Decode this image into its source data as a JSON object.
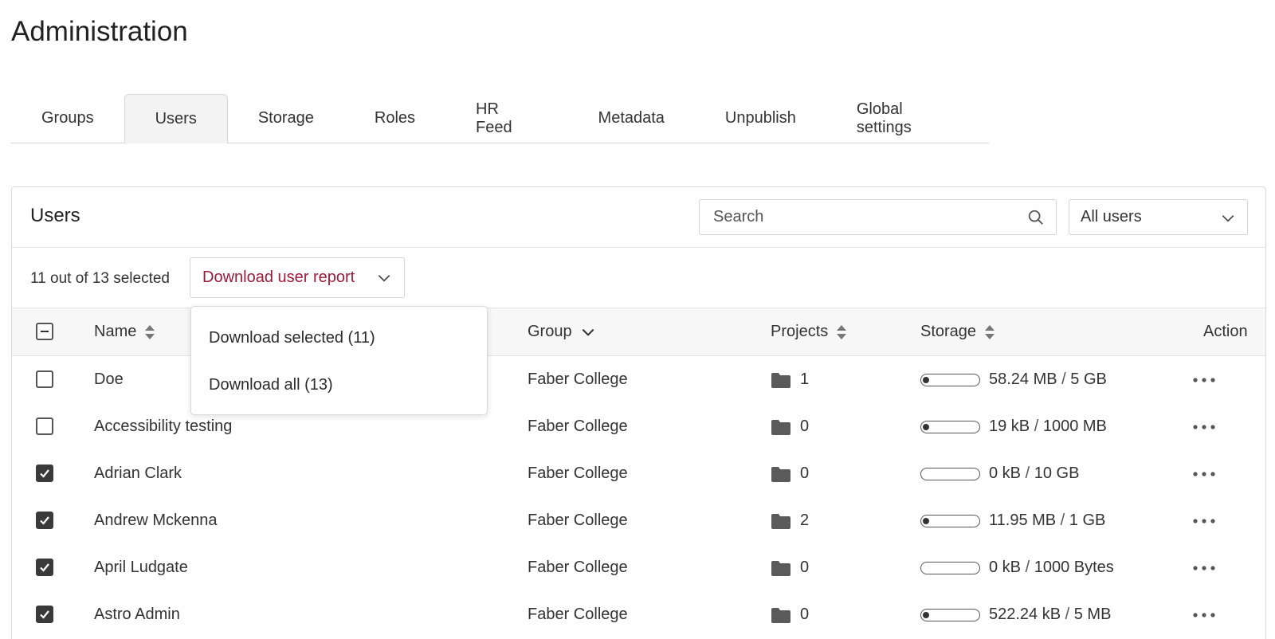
{
  "page": {
    "title": "Administration"
  },
  "tabs": [
    {
      "label": "Groups",
      "active": false
    },
    {
      "label": "Users",
      "active": true
    },
    {
      "label": "Storage",
      "active": false
    },
    {
      "label": "Roles",
      "active": false
    },
    {
      "label": "HR Feed",
      "active": false
    },
    {
      "label": "Metadata",
      "active": false
    },
    {
      "label": "Unpublish",
      "active": false
    },
    {
      "label": "Global settings",
      "active": false
    }
  ],
  "panel": {
    "title": "Users",
    "search": {
      "placeholder": "Search",
      "value": ""
    },
    "filter": {
      "selected": "All users"
    },
    "selection": {
      "text": "11 out of 13 selected"
    },
    "report_dropdown": {
      "label": "Download user report",
      "options": [
        "Download selected (11)",
        "Download all (13)"
      ]
    }
  },
  "table": {
    "headers": {
      "name": "Name",
      "group": "Group",
      "projects": "Projects",
      "storage": "Storage",
      "action": "Action"
    },
    "rows": [
      {
        "checked": false,
        "name": "Doe",
        "group": "Faber College",
        "projects": "1",
        "used": "58.24 MB",
        "quota": "5 GB",
        "usage_fraction": 0.01
      },
      {
        "checked": false,
        "name": "Accessibility testing",
        "group": "Faber College",
        "projects": "0",
        "used": "19 kB",
        "quota": "1000 MB",
        "usage_fraction": 0.01
      },
      {
        "checked": true,
        "name": "Adrian Clark",
        "group": "Faber College",
        "projects": "0",
        "used": "0 kB",
        "quota": "10 GB",
        "usage_fraction": 0
      },
      {
        "checked": true,
        "name": "Andrew Mckenna",
        "group": "Faber College",
        "projects": "2",
        "used": "11.95 MB",
        "quota": "1 GB",
        "usage_fraction": 0.01
      },
      {
        "checked": true,
        "name": "April Ludgate",
        "group": "Faber College",
        "projects": "0",
        "used": "0 kB",
        "quota": "1000 Bytes",
        "usage_fraction": 0
      },
      {
        "checked": true,
        "name": "Astro Admin",
        "group": "Faber College",
        "projects": "0",
        "used": "522.24 kB",
        "quota": "5 MB",
        "usage_fraction": 0.1
      }
    ]
  },
  "colors": {
    "accent": "#9b1b3a",
    "checkbox_checked": "#3a3a3a",
    "header_bg": "#f7f7f7"
  },
  "icons": [
    "search-icon",
    "chevron-down-icon",
    "sort-icon",
    "folder-icon",
    "more-dots-icon",
    "checkbox-indeterminate-icon",
    "checkmark-icon"
  ]
}
